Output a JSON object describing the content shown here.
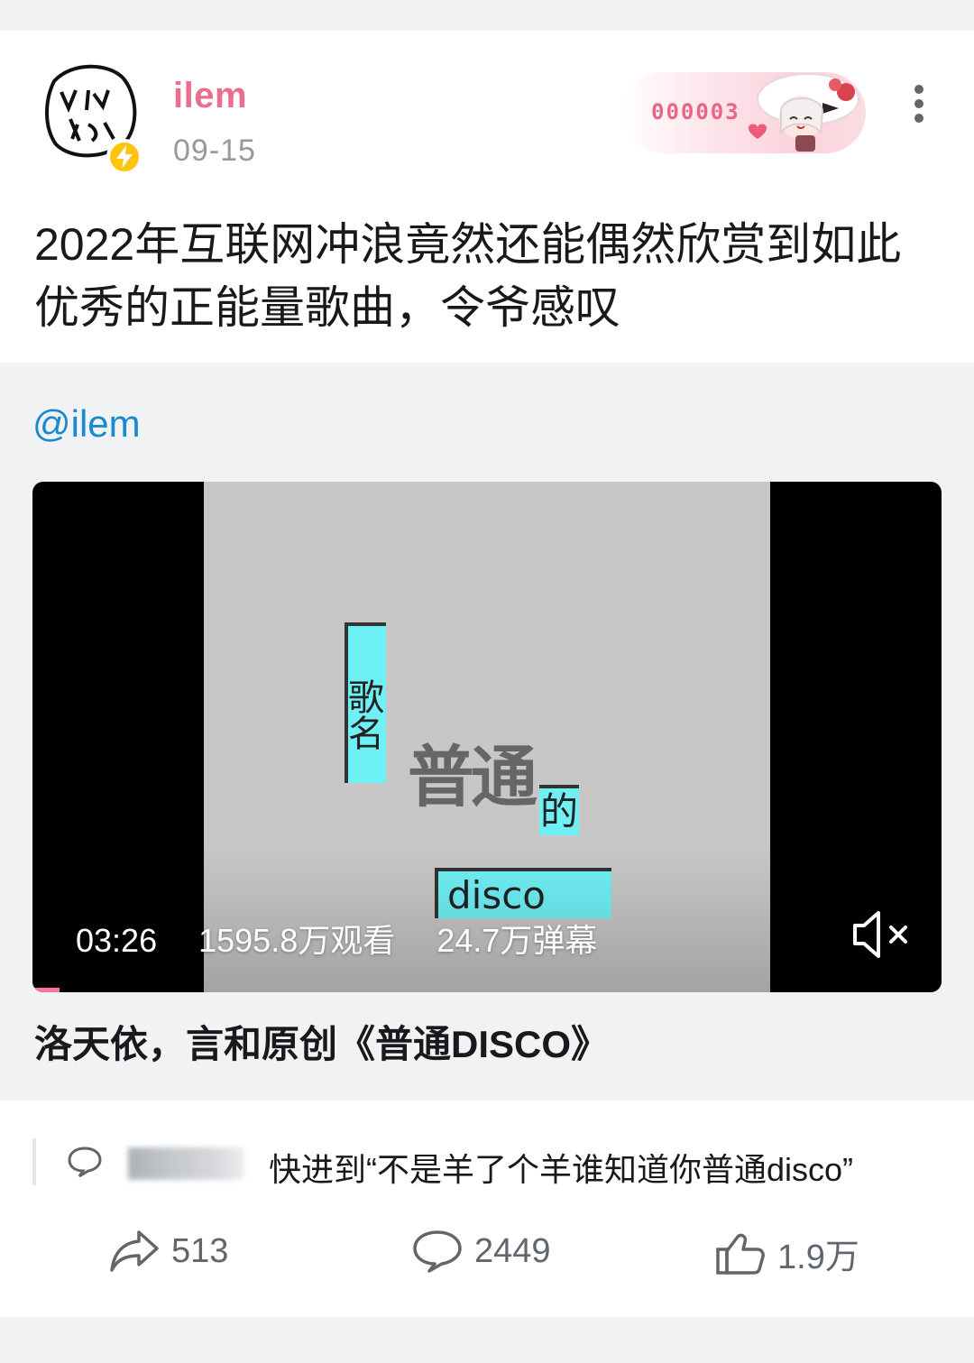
{
  "post": {
    "username": "ilem",
    "date": "09-15",
    "fan_badge_number": "000003",
    "text": "2022年互联网冲浪竟然还能偶然欣赏到如此优秀的正能量歌曲，令爷感叹"
  },
  "repost": {
    "mention": "@ilem",
    "video": {
      "lyrics": {
        "title_label": "歌名",
        "big_word": "普通",
        "de": "的",
        "disco": "disco"
      },
      "duration": "03:26",
      "views": "1595.8万观看",
      "danmaku": "24.7万弹幕",
      "progress_fraction": 0.03
    },
    "video_title": "洛天依，言和原创《普通DISCO》"
  },
  "top_comment": {
    "text": "快进到“不是羊了个羊谁知道你普通disco”"
  },
  "actions": {
    "share_count": "513",
    "comment_count": "2449",
    "like_count": "1.9万"
  },
  "colors": {
    "username": "#ec6e8f",
    "mention": "#178bcf",
    "lyric_box": "#6ff0f5",
    "progress": "#fb7299"
  }
}
